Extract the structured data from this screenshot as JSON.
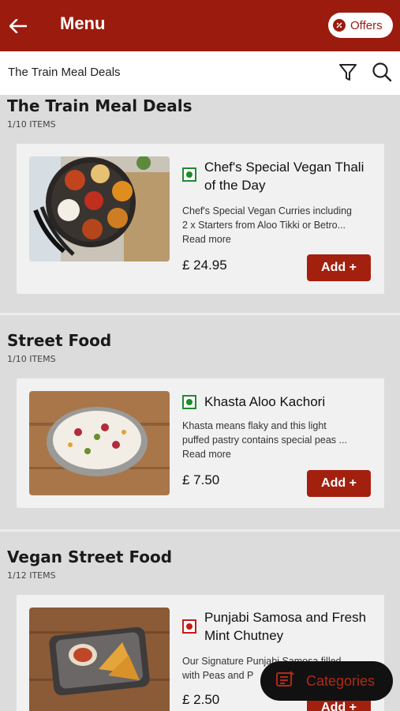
{
  "header": {
    "title": "Menu",
    "offers_label": "Offers"
  },
  "filter": {
    "current": "The Train Meal Deals"
  },
  "sections": [
    {
      "title": "The Train Meal Deals",
      "count": "1/10 ITEMS",
      "item": {
        "name_line1": "Chef's Special Vegan Thali",
        "name_line2": "of the Day",
        "desc_line1": "Chef's Special Vegan Curries including",
        "desc_line2": "2 x Starters from Aloo Tikki or Betro...",
        "read_more": "Read more",
        "price": "£ 24.95",
        "add_label": "Add +",
        "diet": "veg"
      }
    },
    {
      "title": "Street Food",
      "count": "1/10 ITEMS",
      "item": {
        "name_line1": "Khasta Aloo Kachori",
        "desc_line1": "Khasta means flaky and this light",
        "desc_line2": "puffed pastry contains special peas ...",
        "read_more": "Read more",
        "price": "£ 7.50",
        "add_label": "Add +",
        "diet": "veg"
      }
    },
    {
      "title": "Vegan Street Food",
      "count": "1/12 ITEMS",
      "item": {
        "name_line1": "Punjabi Samosa and Fresh",
        "name_line2": "Mint Chutney",
        "desc_line1": "Our Signature Punjabi Samosa filled",
        "desc_line2": "with Peas and P",
        "price": "£ 2.50",
        "add_label": "Add +",
        "diet": "nonveg"
      }
    }
  ],
  "fab": {
    "label": "Categories"
  },
  "colors": {
    "brand": "#9b1b0e",
    "veg": "#1e8a2e",
    "nonveg": "#c71a1a"
  }
}
